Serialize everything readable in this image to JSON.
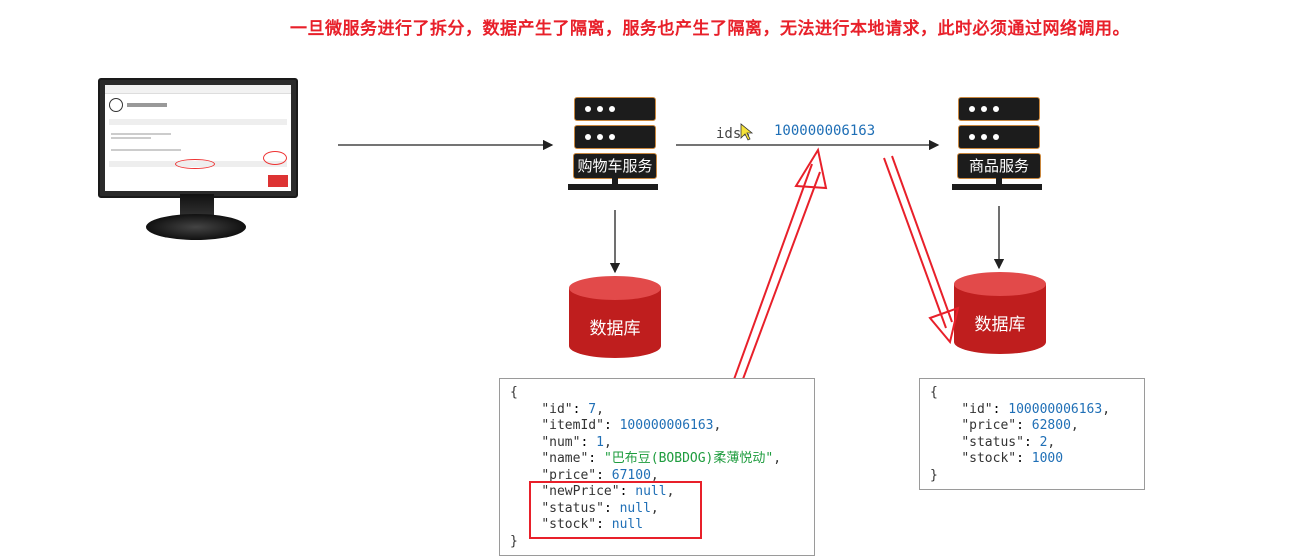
{
  "title": "一旦微服务进行了拆分，数据产生了隔离，服务也产生了隔离，无法进行本地请求，此时必须通过网络调用。",
  "cart_service": {
    "label": "购物车服务"
  },
  "product_service": {
    "label": "商品服务"
  },
  "cart_db": {
    "label": "数据库"
  },
  "product_db": {
    "label": "数据库"
  },
  "request": {
    "param_name": "ids",
    "equals": "=",
    "value": "100000006163"
  },
  "cart_json": {
    "open": "{",
    "close": "}",
    "fields": [
      {
        "key": "\"id\"",
        "value": "7",
        "type": "number",
        "sep": ","
      },
      {
        "key": "\"itemId\"",
        "value": "100000006163",
        "type": "number",
        "sep": ","
      },
      {
        "key": "\"num\"",
        "value": "1",
        "type": "number",
        "sep": ","
      },
      {
        "key": "\"name\"",
        "value": "\"巴布豆(BOBDOG)柔薄悦动\"",
        "type": "string",
        "sep": ","
      },
      {
        "key": "\"price\"",
        "value": "67100",
        "type": "number",
        "sep": ","
      },
      {
        "key": "\"newPrice\"",
        "value": "null",
        "type": "number",
        "sep": ","
      },
      {
        "key": "\"status\"",
        "value": "null",
        "type": "number",
        "sep": ","
      },
      {
        "key": "\"stock\"",
        "value": "null",
        "type": "number",
        "sep": ""
      }
    ]
  },
  "product_json": {
    "open": "{",
    "close": "}",
    "fields": [
      {
        "key": "\"id\"",
        "value": "100000006163",
        "type": "number",
        "sep": ","
      },
      {
        "key": "\"price\"",
        "value": "62800",
        "type": "number",
        "sep": ","
      },
      {
        "key": "\"status\"",
        "value": "2",
        "type": "number",
        "sep": ","
      },
      {
        "key": "\"stock\"",
        "value": "1000",
        "type": "number",
        "sep": ""
      }
    ]
  },
  "colors": {
    "accent_red": "#e8202a",
    "db_red": "#bf1e1e",
    "server_dark": "#1c1c1c",
    "server_border": "#c9873e"
  },
  "icons": [
    "monitor-icon",
    "server-icon",
    "database-icon",
    "cursor-icon"
  ]
}
